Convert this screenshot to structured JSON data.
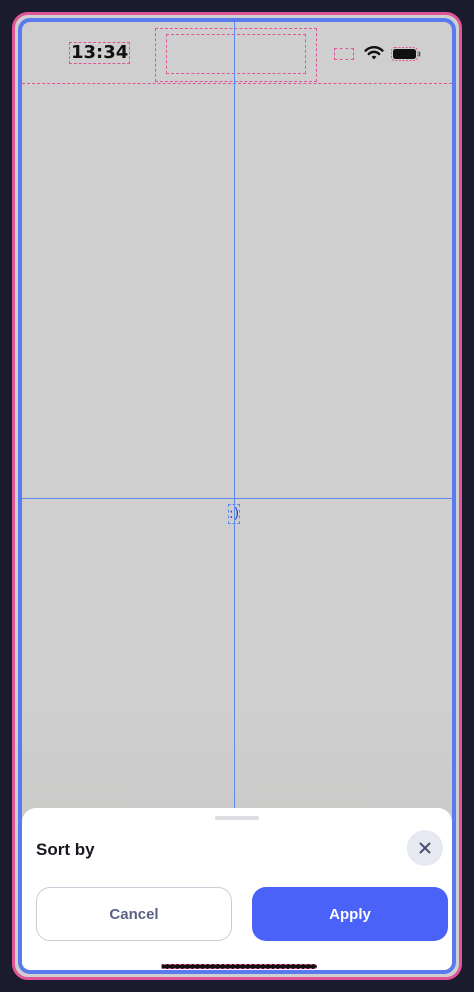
{
  "status_bar": {
    "time": "13:34",
    "icons": [
      "signal-icon",
      "wifi-icon",
      "battery-icon"
    ]
  },
  "canvas": {
    "center_glyph": ":)"
  },
  "sheet": {
    "title": "Sort by",
    "close_icon": "close-icon",
    "cancel_label": "Cancel",
    "apply_label": "Apply"
  },
  "colors": {
    "accent": "#4a62f7",
    "guide": "#5b8bf0",
    "outline": "#e0559a",
    "background": "#cfcfcf"
  }
}
